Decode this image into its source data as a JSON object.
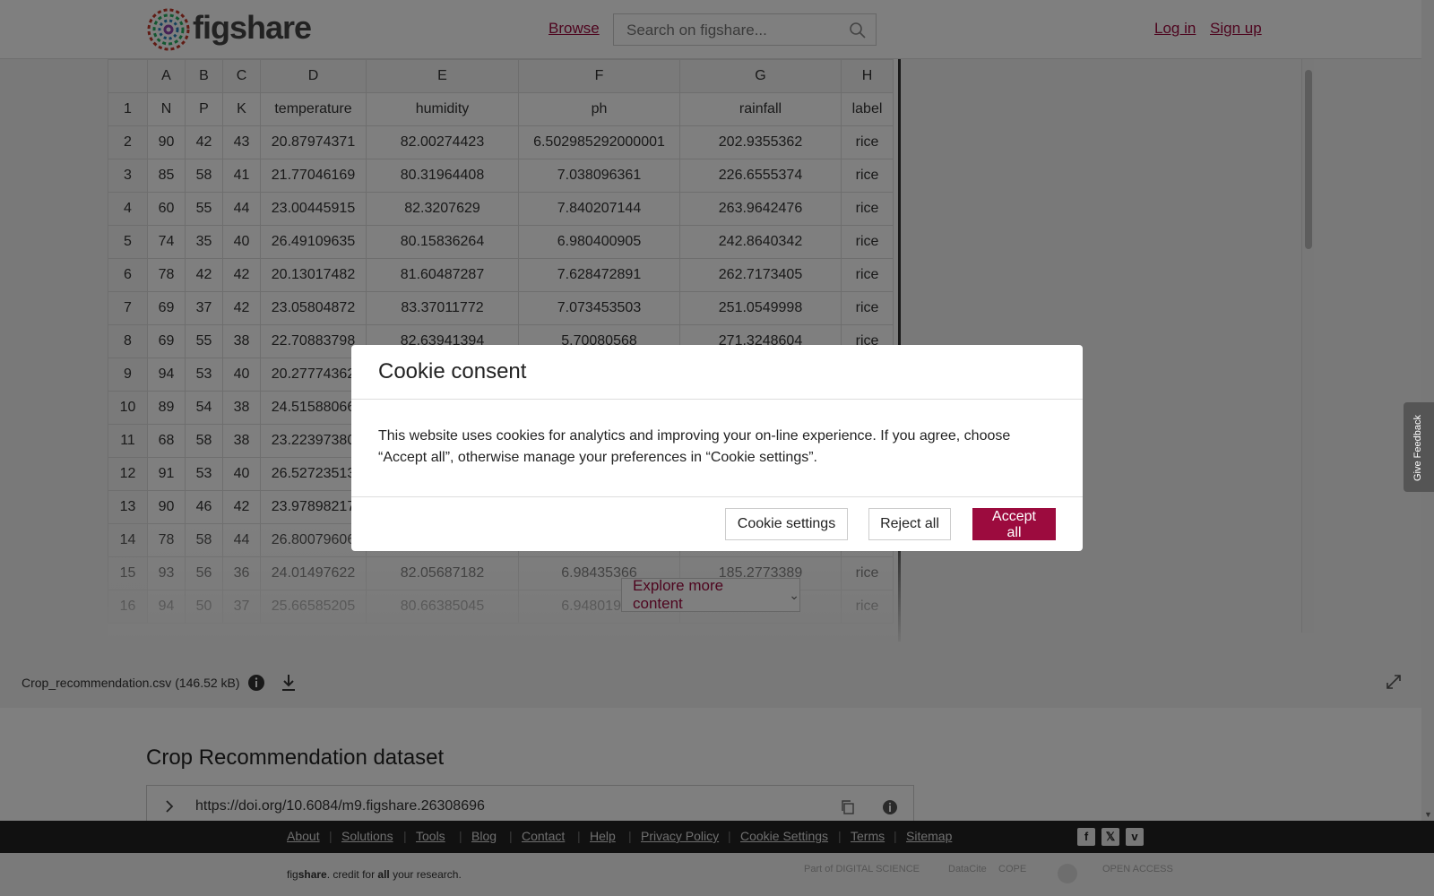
{
  "header": {
    "logo_text": "figshare",
    "browse": "Browse",
    "search_placeholder": "Search on figshare...",
    "login": "Log in",
    "signup": "Sign up"
  },
  "sheet": {
    "col_letters": [
      "A",
      "B",
      "C",
      "D",
      "E",
      "F",
      "G",
      "H"
    ],
    "rows": [
      [
        "1",
        "N",
        "P",
        "K",
        "temperature",
        "humidity",
        "ph",
        "rainfall",
        "label"
      ],
      [
        "2",
        "90",
        "42",
        "43",
        "20.87974371",
        "82.00274423",
        "6.502985292000001",
        "202.9355362",
        "rice"
      ],
      [
        "3",
        "85",
        "58",
        "41",
        "21.77046169",
        "80.31964408",
        "7.038096361",
        "226.6555374",
        "rice"
      ],
      [
        "4",
        "60",
        "55",
        "44",
        "23.00445915",
        "82.3207629",
        "7.840207144",
        "263.9642476",
        "rice"
      ],
      [
        "5",
        "74",
        "35",
        "40",
        "26.49109635",
        "80.15836264",
        "6.980400905",
        "242.8640342",
        "rice"
      ],
      [
        "6",
        "78",
        "42",
        "42",
        "20.13017482",
        "81.60487287",
        "7.628472891",
        "262.7173405",
        "rice"
      ],
      [
        "7",
        "69",
        "37",
        "42",
        "23.05804872",
        "83.37011772",
        "7.073453503",
        "251.0549998",
        "rice"
      ],
      [
        "8",
        "69",
        "55",
        "38",
        "22.70883798",
        "82.63941394",
        "5.70080568",
        "271.3248604",
        "rice"
      ],
      [
        "9",
        "94",
        "53",
        "40",
        "20.27774362",
        "",
        "",
        "",
        ""
      ],
      [
        "10",
        "89",
        "54",
        "38",
        "24.51588066",
        "",
        "",
        "",
        ""
      ],
      [
        "11",
        "68",
        "58",
        "38",
        "23.22397380",
        "",
        "",
        "",
        ""
      ],
      [
        "12",
        "91",
        "53",
        "40",
        "26.52723513",
        "",
        "",
        "",
        ""
      ],
      [
        "13",
        "90",
        "46",
        "42",
        "23.97898217",
        "",
        "",
        "",
        ""
      ],
      [
        "14",
        "78",
        "58",
        "44",
        "26.80079606",
        "",
        "",
        "",
        ""
      ],
      [
        "15",
        "93",
        "56",
        "36",
        "24.01497622",
        "82.05687182",
        "6.98435366",
        "185.2773389",
        "rice"
      ],
      [
        "16",
        "94",
        "50",
        "37",
        "25.66585205",
        "80.66385045",
        "6.94801983",
        "",
        "rice"
      ]
    ],
    "explore_label": "Explore more content",
    "explore_icon": "double-chevron-down-icon"
  },
  "file": {
    "name": "Crop_recommendation.csv",
    "size": "(146.52 kB)"
  },
  "dataset": {
    "title": "Crop Recommendation dataset",
    "doi": "https://doi.org/10.6084/m9.figshare.26308696"
  },
  "footer": {
    "links": [
      "About",
      "Solutions",
      "Tools",
      "Blog",
      "Contact",
      "Help",
      "Privacy Policy",
      "Cookie Settings",
      "Terms",
      "Sitemap"
    ],
    "tagline_prefix": "fig",
    "tagline_brand": "share",
    "tagline_mid": ". credit for ",
    "tagline_bold": "all",
    "tagline_end": " your research.",
    "partners": [
      "Part of DIGITAL SCIENCE",
      "DataCite",
      "COPE",
      "",
      "OPEN ACCESS"
    ],
    "social": [
      "f",
      "𝕏",
      "v"
    ]
  },
  "cookie": {
    "title": "Cookie consent",
    "body": "This website uses cookies for analytics and improving your on-line experience. If you agree, choose “Accept all”, otherwise manage your preferences in “Cookie settings”.",
    "settings_btn": "Cookie settings",
    "reject_btn": "Reject all",
    "accept_btn": "Accept all"
  },
  "feedback": "Give Feedback",
  "colors": {
    "brand": "#9c0b3e",
    "overlay": "rgba(0,0,0,0.5)"
  }
}
